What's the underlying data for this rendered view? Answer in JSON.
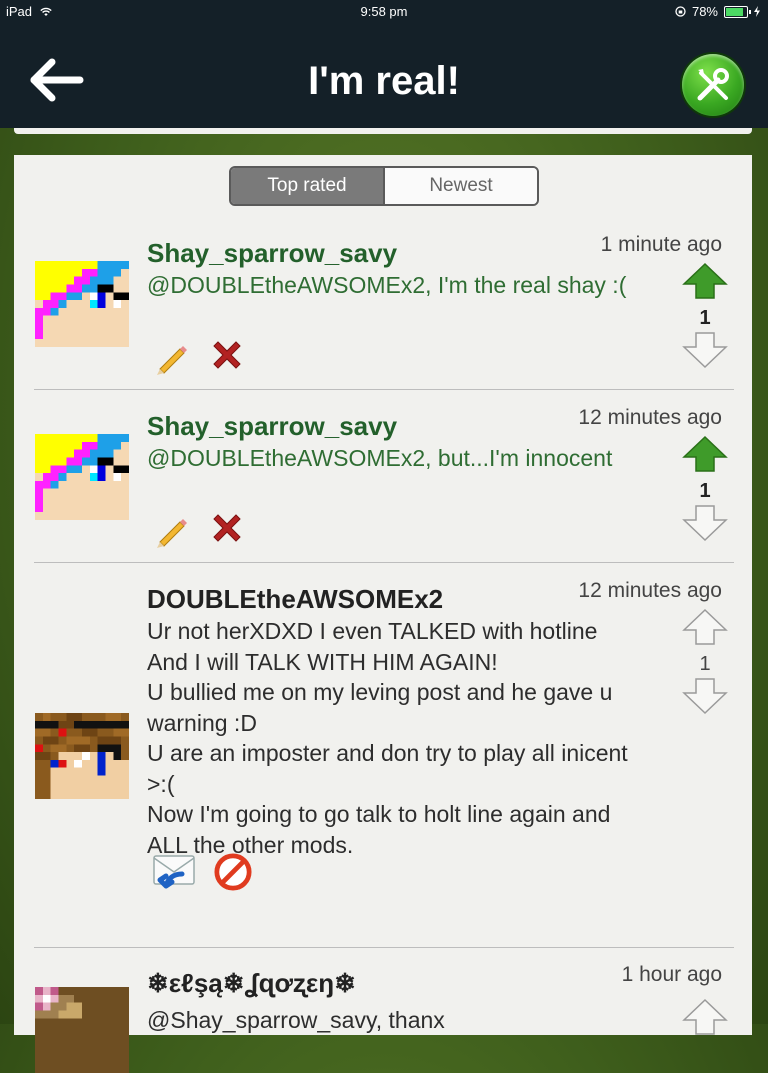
{
  "status_bar": {
    "device": "iPad",
    "time": "9:58 pm",
    "battery": "78%"
  },
  "nav": {
    "title": "I'm real!",
    "back_icon": "back-arrow-icon",
    "settings_icon": "tools-icon"
  },
  "tabs": [
    {
      "label": "Top rated",
      "active": true
    },
    {
      "label": "Newest",
      "active": false
    }
  ],
  "comments": [
    {
      "author": "Shay_sparrow_savy",
      "time": "1 minute ago",
      "text": "@DOUBLEtheAWSOMEx2, I'm the real shay :(",
      "votes": "1",
      "actions": [
        "edit-icon",
        "delete-icon"
      ]
    },
    {
      "author": "Shay_sparrow_savy",
      "time": "12 minutes ago",
      "text": "@DOUBLEtheAWSOMEx2, but...I'm innocent",
      "votes": "1",
      "actions": [
        "edit-icon",
        "delete-icon"
      ]
    },
    {
      "author": "DOUBLEtheAWSOMEx2",
      "time": "12 minutes ago",
      "text": "Ur not herXDXD I even TALKED with hotline\nAnd I will TALK WITH HIM AGAIN!\nU bullied me on my leving post and he gave u warning :D\nU are an imposter and don try to play all inicent >:(\nNow I'm going to go talk to holt line again and ALL the other mods.",
      "votes": "1",
      "actions": [
        "reply-icon",
        "report-icon"
      ]
    },
    {
      "author": "❄εℓşą❄ʆɋơʐεŋ❄",
      "time": "1 hour ago",
      "text": "@Shay_sparrow_savy, thanx"
    }
  ],
  "colors": {
    "nav_bg": "#142028",
    "own_comment_text": "#2f6d33",
    "upvote_active": "#3f9b2a",
    "delete_red": "#b22222"
  }
}
